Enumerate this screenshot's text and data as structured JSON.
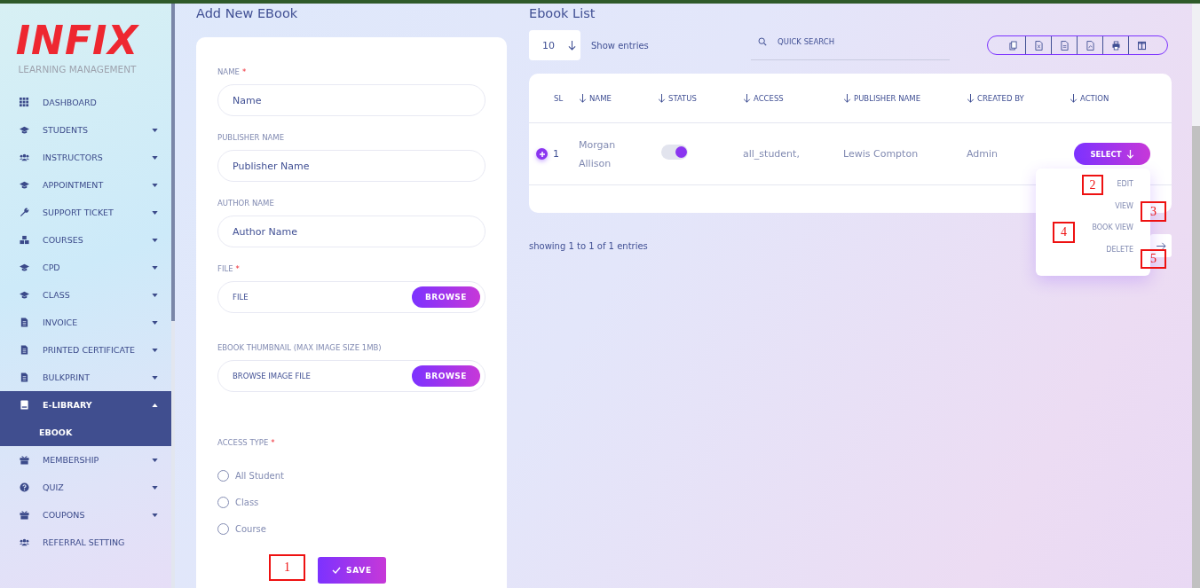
{
  "logo": {
    "brand": "INFIX",
    "tagline": "LEARNING MANAGEMENT"
  },
  "sidebar": {
    "items": [
      {
        "label": "DASHBOARD",
        "kind": "grid",
        "selected": false
      },
      {
        "label": "STUDENTS",
        "kind": "cap",
        "selected": false,
        "expanded": false
      },
      {
        "label": "INSTRUCTORS",
        "kind": "users",
        "selected": false,
        "expanded": false
      },
      {
        "label": "APPOINTMENT",
        "kind": "cap",
        "selected": false,
        "expanded": false
      },
      {
        "label": "SUPPORT TICKET",
        "kind": "wrench",
        "selected": false,
        "expanded": false
      },
      {
        "label": "COURSES",
        "kind": "cubes",
        "selected": false,
        "expanded": false
      },
      {
        "label": "CPD",
        "kind": "cap",
        "selected": false,
        "expanded": false
      },
      {
        "label": "CLASS",
        "kind": "cap",
        "selected": false,
        "expanded": false
      },
      {
        "label": "INVOICE",
        "kind": "doc",
        "selected": false,
        "expanded": false
      },
      {
        "label": "PRINTED CERTIFICATE",
        "kind": "doc",
        "selected": false,
        "expanded": false
      },
      {
        "label": "BULKPRINT",
        "kind": "doc",
        "selected": false,
        "expanded": false
      },
      {
        "label": "E-LIBRARY",
        "kind": "book",
        "selected": true,
        "expanded": true,
        "children": [
          {
            "label": "EBOOK",
            "selected": true
          }
        ]
      },
      {
        "label": "MEMBERSHIP",
        "kind": "gift",
        "selected": false,
        "expanded": false
      },
      {
        "label": "QUIZ",
        "kind": "question",
        "selected": false,
        "expanded": false
      },
      {
        "label": "COUPONS",
        "kind": "gift",
        "selected": false,
        "expanded": false
      },
      {
        "label": "REFERRAL SETTING",
        "kind": "users",
        "selected": false
      }
    ]
  },
  "form": {
    "title": "Add New EBook",
    "fields": [
      {
        "kind": "text",
        "label": "NAME",
        "required_mark": "*",
        "placeholder": "Name"
      },
      {
        "kind": "text",
        "label": "PUBLISHER NAME",
        "placeholder": "Publisher Name"
      },
      {
        "kind": "text",
        "label": "AUTHOR NAME",
        "placeholder": "Author Name"
      },
      {
        "kind": "file",
        "label": "FILE",
        "required_mark": "*",
        "placeholder": "FILE",
        "button": "BROWSE"
      },
      {
        "kind": "file",
        "label": "EBOOK THUMBNAIL (MAX IMAGE SIZE 1MB)",
        "placeholder": "BROWSE IMAGE FILE",
        "button": "BROWSE"
      }
    ],
    "access": {
      "label": "ACCESS TYPE",
      "required_mark": "*",
      "options": [
        {
          "label": "All Student",
          "selected": false
        },
        {
          "label": "Class",
          "selected": false
        },
        {
          "label": "Course",
          "selected": false
        }
      ]
    },
    "save": "SAVE"
  },
  "list": {
    "title": "Ebook List",
    "page_size": "10",
    "show_entries": "Show entries",
    "search": {
      "placeholder": "QUICK SEARCH"
    },
    "table": {
      "columns": [
        "SL",
        "NAME",
        "STATUS",
        "ACCESS",
        "PUBLISHER NAME",
        "CREATED BY",
        "ACTION"
      ],
      "rows": [
        {
          "sl": "1",
          "name": "Morgan Allison",
          "on": true,
          "access": "all_student,",
          "publisher": "Lewis Compton",
          "created_by": "Admin",
          "action": "SELECT"
        }
      ]
    },
    "menu": [
      "EDIT",
      "VIEW",
      "BOOK VIEW",
      "DELETE"
    ],
    "footer": "showing 1 to 1 of 1 entries"
  },
  "markers": [
    "1",
    "2",
    "3",
    "4",
    "5"
  ]
}
